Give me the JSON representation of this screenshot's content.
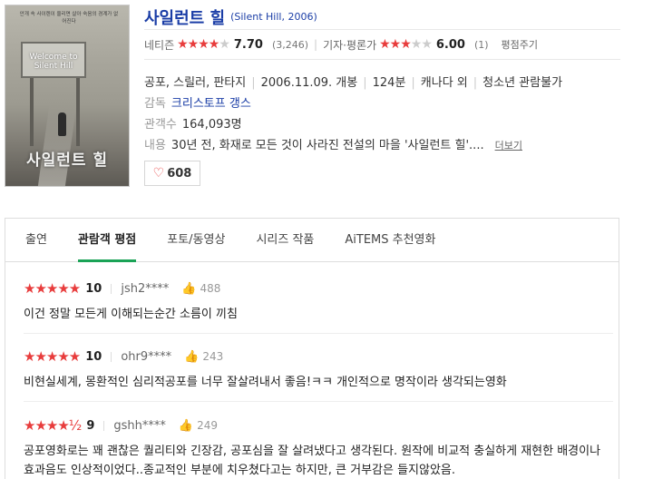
{
  "movie": {
    "title": "사일런트 힐",
    "original_title": "(Silent Hill, 2006)",
    "poster": {
      "title_text": "사일런트 힐",
      "sign_text": "Welcome to Silent Hill",
      "tagline": "안개 속 사이렌이 울리면 살아 숙음의 경계가 없어진다"
    },
    "netizen": {
      "label": "네티즌",
      "stars": "★★★★",
      "stars_off": "★",
      "score": "7.70",
      "count": "(3,246)"
    },
    "critic": {
      "label": "기자·평론가",
      "stars": "★★★",
      "stars_off": "★★",
      "score": "6.00",
      "count": "(1)"
    },
    "rate_link": "평점주기",
    "genre": "공포, 스릴러, 판타지",
    "release": "2006.11.09. 개봉",
    "runtime": "124분",
    "country": "캐나다 외",
    "age": "청소년 관람불가",
    "director_label": "감독",
    "director": "크리스토프 갱스",
    "audience_label": "관객수",
    "audience": "164,093명",
    "plot_label": "내용",
    "plot": "30년 전, 화재로 모든 것이 사라진 전설의 마을 '사일런트 힐'....",
    "more_label": "더보기",
    "likes": "608"
  },
  "tabs": [
    "출연",
    "관람객 평점",
    "포토/동영상",
    "시리즈 작품",
    "AiTEMS 추천영화"
  ],
  "reviews": [
    {
      "stars": "★★★★★",
      "score": "10",
      "user": "jsh2****",
      "likes": "488",
      "text": "이건 정말 모든게 이해되는순간 소름이 끼침"
    },
    {
      "stars": "★★★★★",
      "score": "10",
      "user": "ohr9****",
      "likes": "243",
      "text": "비현실세계, 몽환적인 심리적공포를 너무 잘살려내서 좋음!ㅋㅋ 개인적으로 명작이라 생각되는영화"
    },
    {
      "stars": "★★★★½",
      "score": "9",
      "user": "gshh****",
      "likes": "249",
      "text": "공포영화로는 꽤 괜찮은 퀄리티와 긴장감, 공포심을 잘 살려냈다고 생각된다. 원작에 비교적 충실하게 재현한 배경이나 효과음도 인상적이었다..종교적인 부분에 치우쳤다고는 하지만, 큰 거부감은 들지않았음."
    }
  ]
}
